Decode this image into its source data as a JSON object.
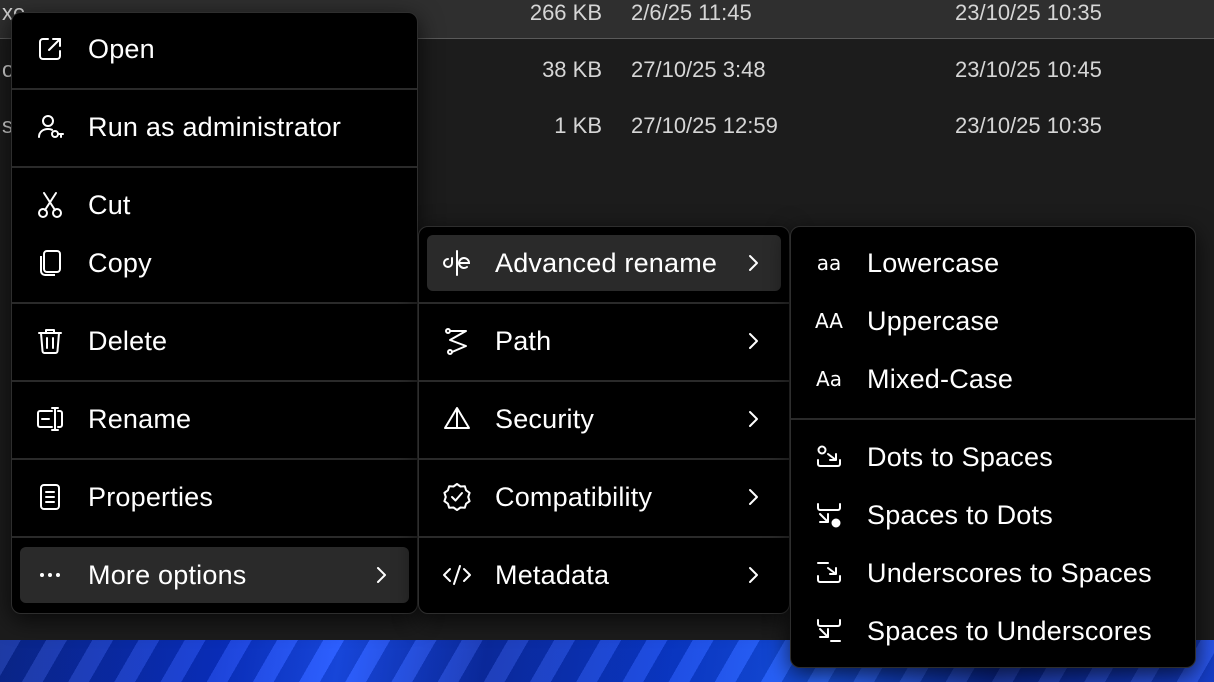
{
  "files": [
    {
      "name": "xe",
      "size": "266 KB",
      "modified": "2/6/25 11:45",
      "created": "23/10/25 10:35",
      "selected": true
    },
    {
      "name": "og",
      "size": "38 KB",
      "modified": "27/10/25 3:48",
      "created": "23/10/25 10:45",
      "selected": false
    },
    {
      "name": "s",
      "size": "1 KB",
      "modified": "27/10/25 12:59",
      "created": "23/10/25 10:35",
      "selected": false
    }
  ],
  "context_menu": {
    "open": "Open",
    "run_as_admin": "Run as administrator",
    "cut": "Cut",
    "copy": "Copy",
    "delete": "Delete",
    "rename": "Rename",
    "properties": "Properties",
    "more_options": "More options"
  },
  "more_options_menu": {
    "advanced_rename": "Advanced rename",
    "path": "Path",
    "security": "Security",
    "compatibility": "Compatibility",
    "metadata": "Metadata"
  },
  "advanced_rename_menu": {
    "lowercase": {
      "label": "Lowercase",
      "glyph": "aa"
    },
    "uppercase": {
      "label": "Uppercase",
      "glyph": "AA"
    },
    "mixed_case": {
      "label": "Mixed-Case",
      "glyph": "Aa"
    },
    "dots_to_spaces": "Dots to Spaces",
    "spaces_to_dots": "Spaces to Dots",
    "underscores_to_spaces": "Underscores to Spaces",
    "spaces_to_underscores": "Spaces to Underscores"
  },
  "colors": {
    "menu_bg": "#000000",
    "highlight": "#2a2a2a",
    "window_bg": "#1c1c1c",
    "wallpaper": "#0a34d6"
  }
}
